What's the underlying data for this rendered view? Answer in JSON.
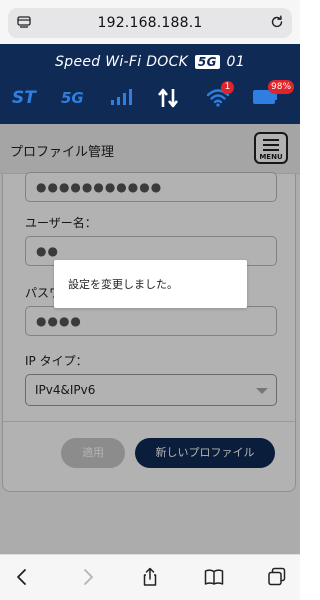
{
  "browser": {
    "url": "192.168.188.1",
    "tabs_icon": "tabs-icon",
    "reload_icon": "reload-icon",
    "toolbar": {
      "back_icon": "back-icon",
      "forward_icon": "forward-icon",
      "share_icon": "share-icon",
      "bookmarks_icon": "bookmarks-icon",
      "tabs_overview_icon": "tabs-overview-icon"
    }
  },
  "header": {
    "brand_prefix": "Speed Wi-Fi DOCK",
    "brand_5g": "5G",
    "brand_suffix": "01",
    "status": {
      "st_label": "ST",
      "network_label": "5G",
      "signal_icon": "signal-icon",
      "data_icon": "updown-arrows-icon",
      "wifi_icon": "wifi-icon",
      "wifi_clients": "1",
      "battery_icon": "battery-icon",
      "battery_percent": "98%"
    },
    "colors": {
      "header_bg": "#0f2a55",
      "accent_blue": "#2f7fe0",
      "badge_red": "#e0242b"
    }
  },
  "page": {
    "title": "プロファイル管理",
    "menu_label": "MENU"
  },
  "form": {
    "profile_field_value": "●●●●●●●●●●●",
    "username_label": "ユーザー名：",
    "username_value": "●●",
    "password_label": "パスワード：",
    "password_value": "●●●●",
    "ip_type_label": "IP タイプ：",
    "ip_type_value": "IPv4&IPv6",
    "apply_button": "適用",
    "new_profile_button": "新しいプロファイル"
  },
  "toast": {
    "message": "設定を変更しました。"
  }
}
